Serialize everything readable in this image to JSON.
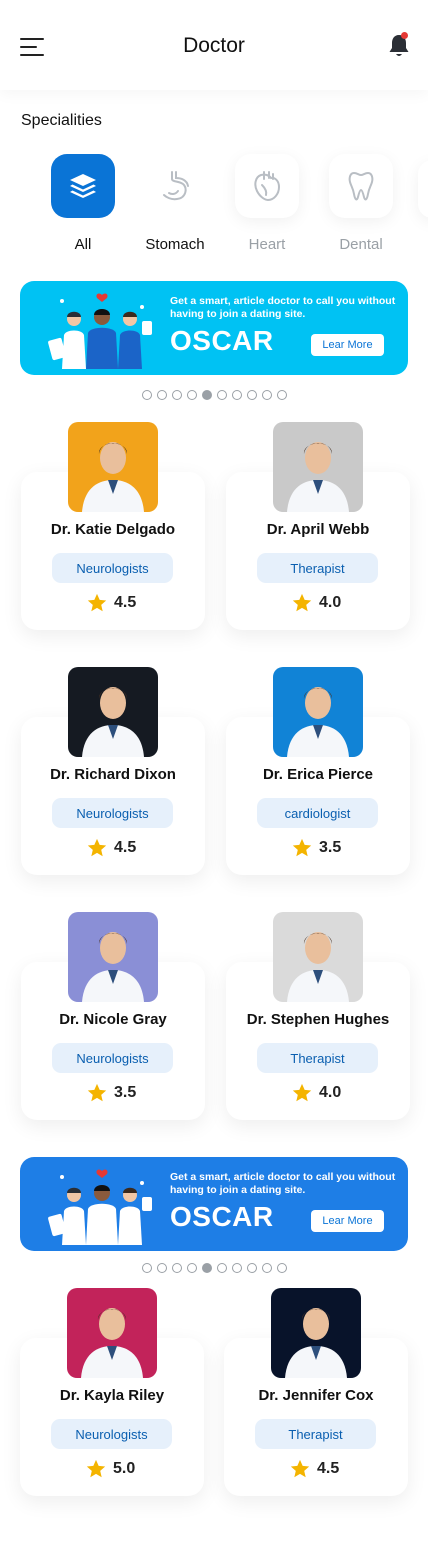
{
  "header": {
    "title": "Doctor",
    "menu_icon": "hamburger-menu-icon",
    "bell_icon": "bell-icon",
    "notification_color": "#e53935"
  },
  "specialities": {
    "title": "Specialities",
    "items": [
      {
        "label": "All",
        "icon": "layers-icon",
        "active": true
      },
      {
        "label": "Stomach",
        "icon": "stomach-icon"
      },
      {
        "label": "Heart",
        "icon": "heart-organ-icon"
      },
      {
        "label": "Dental",
        "icon": "tooth-icon"
      }
    ]
  },
  "banners": [
    {
      "tagline": "Get a smart, article doctor to call you without having to join a dating site.",
      "brand": "OSCAR",
      "button": "Lear More",
      "color": "#00c2f3"
    },
    {
      "tagline": "Get a smart, article doctor to call you without having to join a dating site.",
      "brand": "OSCAR",
      "button": "Lear More",
      "color": "#1e7ee6"
    }
  ],
  "carousel": {
    "total_dots": 10,
    "active_index": 4
  },
  "doctors": [
    {
      "name": "Dr. Katie Delgado",
      "specialty": "Neurologists",
      "rating": "4.5",
      "photo_bg": "#f2a31b"
    },
    {
      "name": "Dr. April Webb",
      "specialty": "Therapist",
      "rating": "4.0",
      "photo_bg": "#c9c9c9"
    },
    {
      "name": "Dr. Richard Dixon",
      "specialty": "Neurologists",
      "rating": "4.5",
      "photo_bg": "#151a22"
    },
    {
      "name": "Dr. Erica Pierce",
      "specialty": "cardiologist",
      "rating": "3.5",
      "photo_bg": "#1183d6"
    },
    {
      "name": "Dr. Nicole Gray",
      "specialty": "Neurologists",
      "rating": "3.5",
      "photo_bg": "#8a8fd6"
    },
    {
      "name": "Dr. Stephen Hughes",
      "specialty": "Therapist",
      "rating": "4.0",
      "photo_bg": "#dadada"
    },
    {
      "name": "Dr. Kayla Riley",
      "specialty": "Neurologists",
      "rating": "5.0",
      "photo_bg": "#c2235a"
    },
    {
      "name": "Dr. Jennifer Cox",
      "specialty": "Therapist",
      "rating": "4.5",
      "photo_bg": "#08132a"
    }
  ],
  "star_color": "#f4b400",
  "accent": "#0a74d6"
}
